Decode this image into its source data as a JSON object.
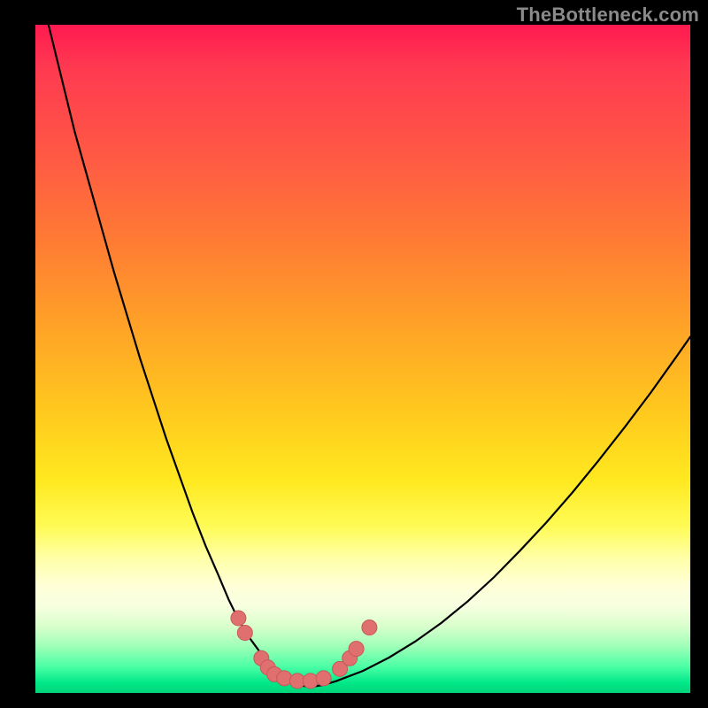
{
  "watermark": "TheBottleneck.com",
  "chart_data": {
    "type": "line",
    "title": "",
    "xlabel": "",
    "ylabel": "",
    "xlim": [
      0,
      100
    ],
    "ylim": [
      0,
      100
    ],
    "series": [
      {
        "name": "curve",
        "x": [
          2,
          4,
          6,
          8,
          10,
          12,
          14,
          16,
          18,
          20,
          22,
          24,
          26,
          28,
          29.5,
          31,
          32.5,
          34,
          35,
          36,
          37,
          38,
          39,
          40,
          42,
          44,
          46,
          50,
          54,
          58,
          62,
          66,
          70,
          74,
          78,
          82,
          86,
          90,
          94,
          98,
          100
        ],
        "y": [
          100,
          92,
          84,
          77,
          70,
          63,
          56.5,
          50,
          44,
          38,
          32.5,
          27,
          22,
          17.5,
          14,
          11,
          8.5,
          6.5,
          5,
          3.8,
          2.9,
          2.2,
          1.6,
          1.2,
          0.9,
          1.2,
          1.8,
          3.3,
          5.3,
          7.7,
          10.5,
          13.7,
          17.3,
          21.3,
          25.5,
          30,
          34.8,
          39.8,
          45,
          50.5,
          53.3
        ]
      }
    ],
    "markers": [
      {
        "x": 31.0,
        "y": 11.2
      },
      {
        "x": 32.0,
        "y": 9.0
      },
      {
        "x": 34.5,
        "y": 5.2
      },
      {
        "x": 35.5,
        "y": 3.8
      },
      {
        "x": 36.5,
        "y": 2.8
      },
      {
        "x": 38.0,
        "y": 2.2
      },
      {
        "x": 40.0,
        "y": 1.8
      },
      {
        "x": 42.0,
        "y": 1.8
      },
      {
        "x": 44.0,
        "y": 2.2
      },
      {
        "x": 46.5,
        "y": 3.6
      },
      {
        "x": 48.0,
        "y": 5.2
      },
      {
        "x": 49.0,
        "y": 6.6
      },
      {
        "x": 51.0,
        "y": 9.8
      }
    ],
    "colors": {
      "curve": "#000000",
      "marker_fill": "#e07070",
      "marker_stroke": "#c85858"
    }
  }
}
